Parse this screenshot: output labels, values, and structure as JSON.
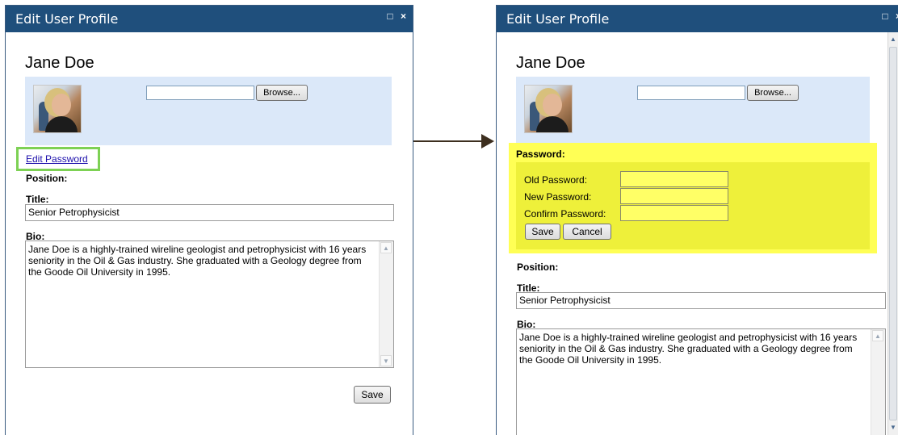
{
  "left_dialog": {
    "title": "Edit User Profile",
    "name": "Jane Doe",
    "browse_label": "Browse...",
    "edit_password_link": "Edit Password",
    "position_label": "Position:",
    "title_label": "Title:",
    "title_value": "Senior Petrophysicist",
    "bio_label": "Bio:",
    "bio_value": "Jane Doe is a highly-trained wireline geologist and petrophysicist with 16 years seniority in the Oil & Gas industry. She graduated with a Geology degree from the Goode Oil University in 1995.",
    "save_label": "Save"
  },
  "right_dialog": {
    "title": "Edit User Profile",
    "name": "Jane Doe",
    "browse_label": "Browse...",
    "password_heading": "Password:",
    "old_password_label": "Old Password:",
    "new_password_label": "New Password:",
    "confirm_password_label": "Confirm Password:",
    "pw_save_label": "Save",
    "pw_cancel_label": "Cancel",
    "position_label": "Position:",
    "title_label": "Title:",
    "title_value": "Senior Petrophysicist",
    "bio_label": "Bio:",
    "bio_value": "Jane Doe is a highly-trained wireline geologist and petrophysicist with 16 years seniority in the Oil & Gas industry. She graduated with a Geology degree from the Goode Oil University in 1995."
  },
  "window_buttons": {
    "maximize_glyph": "□",
    "close_glyph": "×"
  },
  "colors": {
    "titlebar": "#1f4f7c",
    "photo_panel": "#dbe8f9",
    "highlight_green": "#7dd154",
    "password_yellow": "#ffff55",
    "arrow": "#3d2f1f"
  }
}
